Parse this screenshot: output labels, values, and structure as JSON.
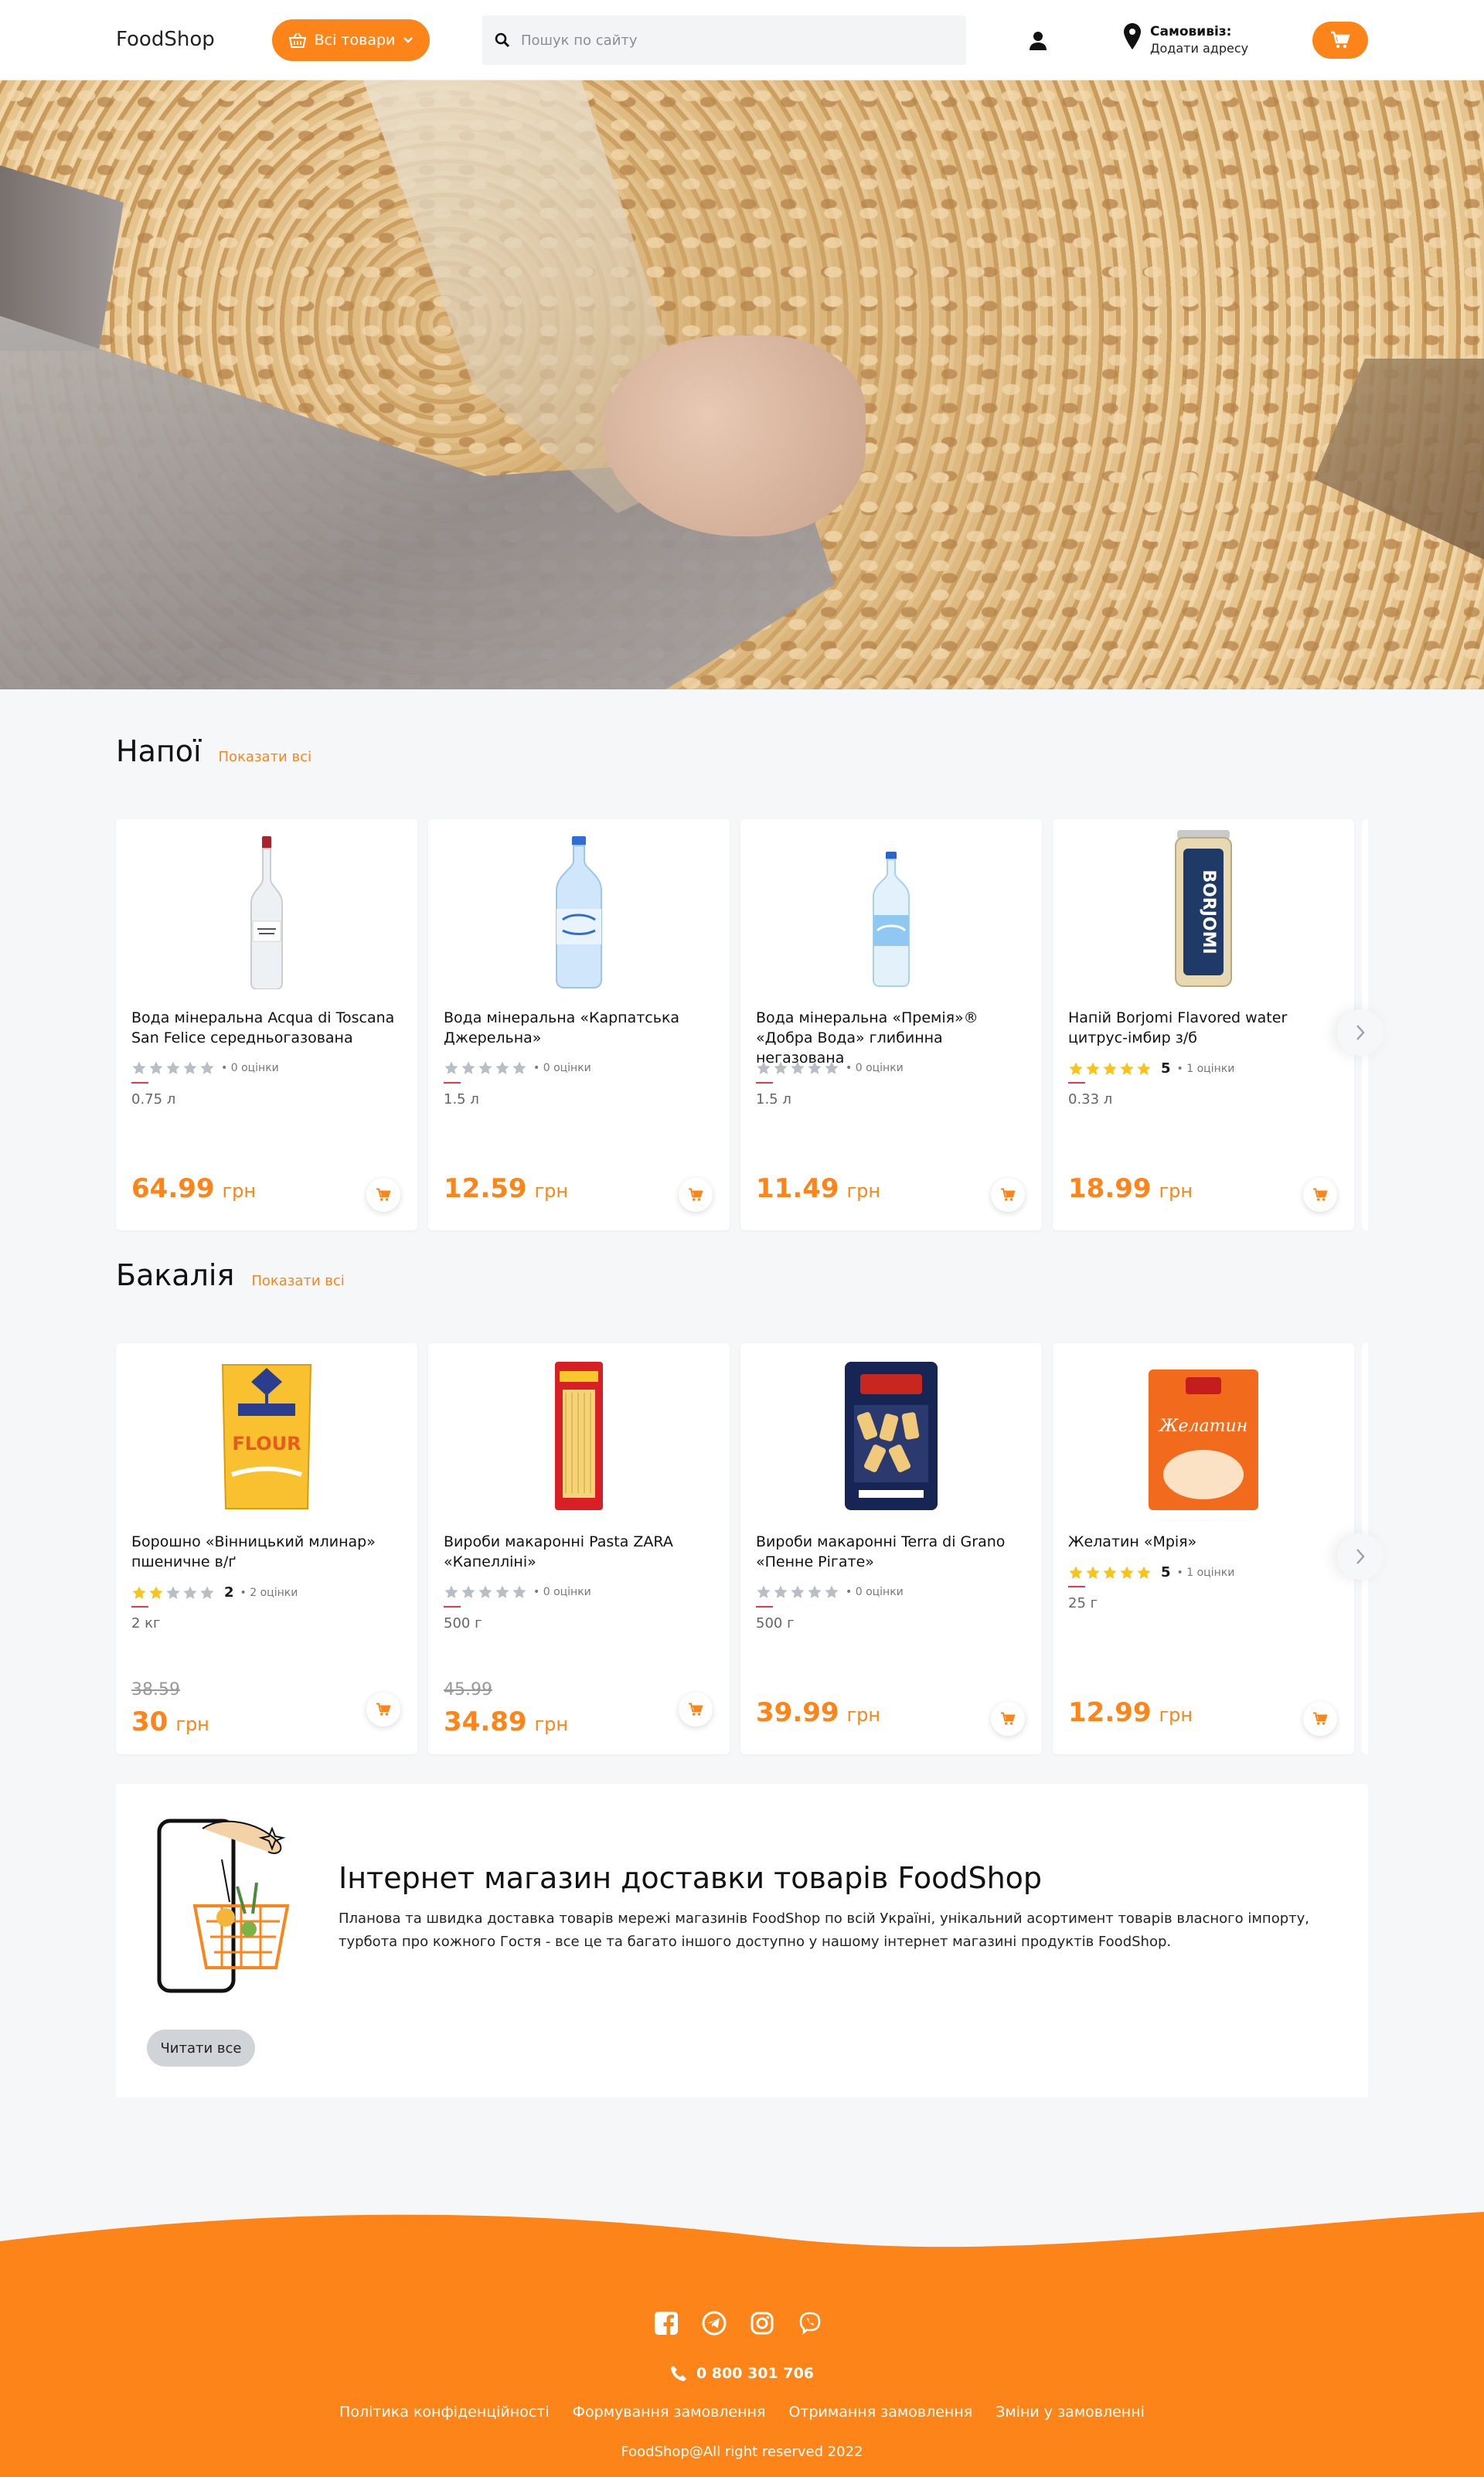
{
  "header": {
    "logo": "FoodShop",
    "all_goods_label": "Всі товари",
    "search_placeholder": "Пошук по сайту",
    "pickup_title": "Самовивіз:",
    "pickup_subtitle": "Додати адресу"
  },
  "colors": {
    "accent": "#fd8419",
    "star_filled": "#f8c31a",
    "star_empty": "#b9bdc4",
    "rating_line": "#e5384e"
  },
  "drinks": {
    "title": "Напої",
    "show_all": "Показати всі",
    "products": [
      {
        "name": "Вода мінеральна Acqua di Toscana San Felice середньогазована",
        "rating": 0,
        "rating_num": "",
        "rating_count": "• 0 оцінки",
        "volume": "0.75 л",
        "old_price": "",
        "price": "64.99",
        "currency": "грн",
        "image": "glass-bottle"
      },
      {
        "name": "Вода мінеральна «Карпатська Джерельна»",
        "rating": 0,
        "rating_num": "",
        "rating_count": "• 0 оцінки",
        "volume": "1.5 л",
        "old_price": "",
        "price": "12.59",
        "currency": "грн",
        "image": "plastic-bottle-blue"
      },
      {
        "name": "Вода мінеральна «Премія»® «Добра Вода» глибинна негазована",
        "rating": 0,
        "rating_num": "",
        "rating_count": "• 0 оцінки",
        "volume": "1.5 л",
        "old_price": "",
        "price": "11.49",
        "currency": "грн",
        "image": "plastic-bottle-clear"
      },
      {
        "name": "Напій Borjomi Flavored water цитрус-імбир з/б",
        "rating": 5,
        "rating_num": "5",
        "rating_count": "• 1 оцінки",
        "volume": "0.33 л",
        "old_price": "",
        "price": "18.99",
        "currency": "грн",
        "image": "can"
      }
    ]
  },
  "grocery": {
    "title": "Бакалія",
    "show_all": "Показати всі",
    "products": [
      {
        "name": "Борошно «Вінницький млинар» пшеничне в/ґ",
        "rating": 2,
        "rating_num": "2",
        "rating_count": "• 2 оцінки",
        "volume": "2 кг",
        "old_price": "38.59",
        "price": "30",
        "currency": "грн",
        "image": "flour-bag"
      },
      {
        "name": "Вироби макаронні Pasta ZARA «Капелліні»",
        "rating": 0,
        "rating_num": "",
        "rating_count": "• 0 оцінки",
        "volume": "500 г",
        "old_price": "45.99",
        "price": "34.89",
        "currency": "грн",
        "image": "pasta-red"
      },
      {
        "name": "Вироби макаронні Terra di Grano «Пенне Рігате»",
        "rating": 0,
        "rating_num": "",
        "rating_count": "• 0 оцінки",
        "volume": "500 г",
        "old_price": "",
        "price": "39.99",
        "currency": "грн",
        "image": "pasta-blue"
      },
      {
        "name": "Желатин «Мрія»",
        "rating": 5,
        "rating_num": "5",
        "rating_count": "• 1 оцінки",
        "volume": "25 г",
        "old_price": "",
        "price": "12.99",
        "currency": "грн",
        "image": "gelatin-pack"
      }
    ]
  },
  "about": {
    "title": "Інтернет магазин доставки товарів FoodShop",
    "text": "Планова та швидка доставка товарів мережі магазинів FoodShop по всій Україні, унікальний асортимент товарів власного імпорту, турбота про кожного Гостя - все це та багато іншого доступно у нашому інтернет магазині продуктів FoodShop.",
    "read_all": "Читати все"
  },
  "footer": {
    "socials": [
      "facebook-icon",
      "telegram-icon",
      "instagram-icon",
      "viber-icon"
    ],
    "phone": "0 800 301 706",
    "links": [
      "Політика конфіденційності",
      "Формування замовлення",
      "Отримання замовлення",
      "Зміни у замовленні"
    ],
    "copyright": "FoodShop@All right reserved 2022"
  }
}
